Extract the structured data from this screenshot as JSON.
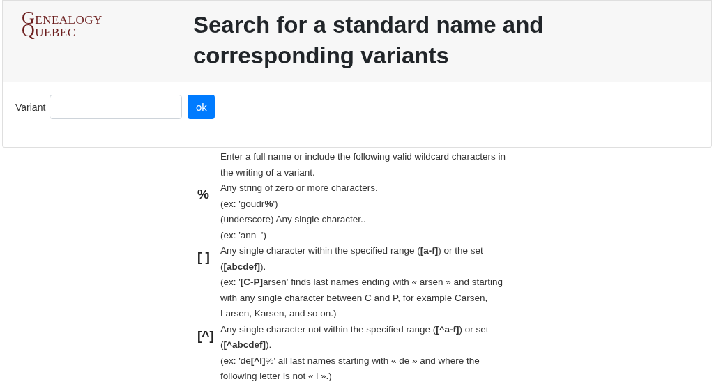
{
  "logo": {
    "lines": [
      "GENEALOGY",
      "QUEBEC"
    ]
  },
  "title": "Search for a standard name and corresponding variants",
  "form": {
    "label": "Variant",
    "button": "ok"
  },
  "help": {
    "intro": "Enter a full name or include the following valid wildcard characters in the writing of a variant.",
    "wildcards": [
      {
        "symbol": "%",
        "lines": [
          "Any string of zero or more characters.",
          "(ex: 'goudr**%**')"
        ]
      },
      {
        "symbol": "_",
        "lines": [
          "(underscore) Any single character..",
          "(ex: 'ann_')"
        ]
      },
      {
        "symbol": "[ ]",
        "lines": [
          "Any single character within the specified range (**[a-f]**) or the set (**[abcdef]**).",
          "(ex: '**[C-P]**arsen' finds last names ending with « arsen » and starting with any single character between C and P, for example Carsen, Larsen, Karsen, and so on.)"
        ]
      },
      {
        "symbol": "[^]",
        "lines": [
          "Any single character not within the specified range (**[^a-f]**) or set (**[^abcdef]**).",
          "(ex: 'de**[^l]**%' all last names starting with « de » and where the following letter is not « l ».)"
        ]
      }
    ]
  }
}
